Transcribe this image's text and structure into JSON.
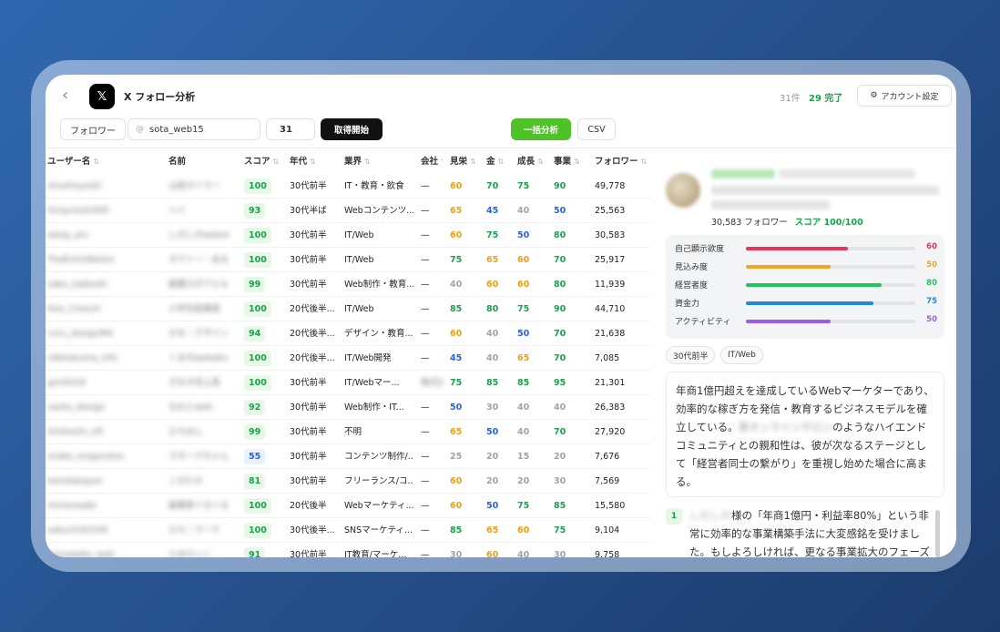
{
  "header": {
    "back_icon": "chevron-left-icon",
    "logo_text": "𝕏",
    "title": "X フォロー分析",
    "count": "31件",
    "done": "29 完了",
    "account_settings": "アカウント設定"
  },
  "controls": {
    "mode": "フォロワー",
    "at": "@",
    "username": "sota_web15",
    "count": "31",
    "start": "取得開始",
    "bulk": "一括分析",
    "csv": "CSV"
  },
  "table": {
    "columns": {
      "user": "ユーザー名",
      "name": "名前",
      "score": "スコア",
      "age": "年代",
      "job": "業界",
      "company": "会社",
      "mie": "見栄",
      "kin": "金",
      "seicho": "成長",
      "jigyo": "事業",
      "followers": "フォロワー"
    },
    "rows": [
      {
        "user": "shushiryoshi",
        "name": "山田タイラー",
        "score": "100",
        "age": "30代前半",
        "job": "IT・教育・飲食",
        "company": "—",
        "mie": "60",
        "kin": "70",
        "seicho": "75",
        "jigyo": "90",
        "followers": "49,778"
      },
      {
        "user": "hiraynoshi505",
        "name": "ハイ",
        "score": "93",
        "age": "30代半ば",
        "job": "Webコンテンツ...",
        "company": "—",
        "mie": "65",
        "kin": "45",
        "seicho": "40",
        "jigyo": "50",
        "followers": "25,563"
      },
      {
        "user": "sleep_am",
        "name": "しのしのwebm",
        "score": "100",
        "age": "30代前半",
        "job": "IT/Web",
        "company": "—",
        "mie": "60",
        "kin": "75",
        "seicho": "50",
        "jigyo": "80",
        "followers": "30,583"
      },
      {
        "user": "TheEntrelNotes",
        "name": "オクトー・ある",
        "score": "100",
        "age": "30代前半",
        "job": "IT/Web",
        "company": "—",
        "mie": "75",
        "kin": "65",
        "seicho": "60",
        "jigyo": "70",
        "followers": "25,917"
      },
      {
        "user": "sabu_kaikoshi",
        "name": "副業ロボアとも",
        "score": "99",
        "age": "30代前半",
        "job": "Web制作・教育...",
        "company": "—",
        "mie": "40",
        "kin": "60",
        "seicho": "60",
        "jigyo": "80",
        "followers": "11,939"
      },
      {
        "user": "fore_Crescel",
        "name": "小学生起業家",
        "score": "100",
        "age": "20代後半...",
        "job": "IT/Web",
        "company": "—",
        "mie": "85",
        "kin": "80",
        "seicho": "75",
        "jigyo": "90",
        "followers": "44,710"
      },
      {
        "user": "curu_designMd",
        "name": "かな｜デザイン",
        "score": "94",
        "age": "20代後半...",
        "job": "デザイン・教育...",
        "company": "—",
        "mie": "60",
        "kin": "40",
        "seicho": "50",
        "jigyo": "70",
        "followers": "21,638"
      },
      {
        "user": "nikkiokuma_info",
        "name": "くまのwebdev",
        "score": "100",
        "age": "20代後半...",
        "job": "IT/Web開発",
        "company": "—",
        "mie": "45",
        "kin": "40",
        "seicho": "65",
        "jigyo": "70",
        "followers": "7,085"
      },
      {
        "user": "gon9316",
        "name": "ずおネ売上長",
        "score": "100",
        "age": "30代前半",
        "job": "IT/Webマー...",
        "company": "株式会社",
        "mie": "75",
        "kin": "85",
        "seicho": "85",
        "jigyo": "95",
        "followers": "21,301"
      },
      {
        "user": "naoto_design",
        "name": "なおとweb",
        "score": "92",
        "age": "30代前半",
        "job": "Web制作・IT...",
        "company": "—",
        "mie": "50",
        "kin": "30",
        "seicho": "40",
        "jigyo": "40",
        "followers": "26,383"
      },
      {
        "user": "hirohoshi_nft",
        "name": "ひろほし",
        "score": "99",
        "age": "30代前半",
        "job": "不明",
        "company": "—",
        "mie": "65",
        "kin": "50",
        "seicho": "40",
        "jigyo": "70",
        "followers": "27,920"
      },
      {
        "user": "snake_moguraine",
        "name": "スネークちゃん",
        "score": "55",
        "age": "30代前半",
        "job": "コンテンツ制作/...",
        "company": "—",
        "mie": "25",
        "kin": "20",
        "seicho": "15",
        "jigyo": "20",
        "followers": "7,676"
      },
      {
        "user": "konotakayon",
        "name": "このたか",
        "score": "81",
        "age": "30代前半",
        "job": "フリーランス/コ...",
        "company": "—",
        "mie": "60",
        "kin": "20",
        "seicho": "20",
        "jigyo": "30",
        "followers": "7,569"
      },
      {
        "user": "miroenaabi",
        "name": "副業家ぐるぐる",
        "score": "100",
        "age": "20代後半",
        "job": "Webマーケティ...",
        "company": "—",
        "mie": "60",
        "kin": "50",
        "seicho": "75",
        "jigyo": "85",
        "followers": "15,580"
      },
      {
        "user": "sabuchi02345",
        "name": "ひろ｜マーケ",
        "score": "100",
        "age": "30代後半...",
        "job": "SNSマーケティ...",
        "company": "—",
        "mie": "85",
        "kin": "65",
        "seicho": "60",
        "jigyo": "75",
        "followers": "9,104"
      },
      {
        "user": "himadaiko_web",
        "name": "ひまだいこ",
        "score": "91",
        "age": "30代前半",
        "job": "IT教育/マーケ...",
        "company": "—",
        "mie": "30",
        "kin": "60",
        "seicho": "40",
        "jigyo": "30",
        "followers": "9,758"
      }
    ]
  },
  "detail": {
    "followers": "30,583 フォロワー",
    "score": "スコア 100/100",
    "metrics": [
      {
        "label": "自己顕示欲度",
        "value": 60,
        "color": "#e8335a"
      },
      {
        "label": "見込み度",
        "value": 50,
        "color": "#f5a524"
      },
      {
        "label": "経営者度",
        "value": 80,
        "color": "#22c55e"
      },
      {
        "label": "資金力",
        "value": 75,
        "color": "#1e88e5"
      },
      {
        "label": "アクティビティ",
        "value": 50,
        "color": "#9b5de5"
      }
    ],
    "tags": [
      "30代前半",
      "IT/Web"
    ],
    "desc_pre": "年商1億円超えを達成しているWebマーケターであり、効率的な稼ぎ方を発信・教育するビジネスモデルを確立している。",
    "desc_blur": "某オンラインサロン",
    "desc_post": "のようなハイエンドコミュニティとの親和性は、彼が次なるステージとして「経営者同士の繋がり」を重視し始めた場合に高まる。",
    "msg_num": "1",
    "msg_blur": "しのしの",
    "msg_text": "様の「年商1億円・利益率80%」という非常に効率的な事業構築手法に大変感銘を受けました。もしよろしければ、更なる事業拡大のフェーズとして、"
  },
  "colors": {
    "green": "#16a34a",
    "orange": "#f59e0b",
    "blue": "#2563eb",
    "gray": "#a3a3a3",
    "bulk_button": "#4ec227"
  }
}
